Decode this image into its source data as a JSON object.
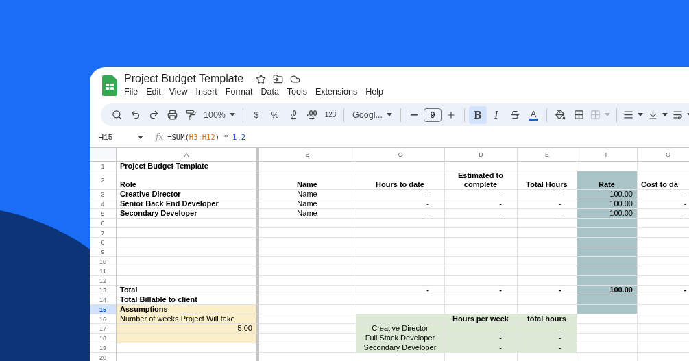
{
  "document": {
    "title": "Project Budget Template"
  },
  "menu": [
    {
      "label": "File"
    },
    {
      "label": "Edit"
    },
    {
      "label": "View"
    },
    {
      "label": "Insert"
    },
    {
      "label": "Format"
    },
    {
      "label": "Data"
    },
    {
      "label": "Tools"
    },
    {
      "label": "Extensions"
    },
    {
      "label": "Help"
    }
  ],
  "toolbar": {
    "zoom": "100%",
    "currency": "$",
    "percent": "%",
    "decrease_decimals": ".0",
    "increase_decimals": ".00",
    "number_format": "123",
    "font": "Googl...",
    "font_size": "9",
    "bold": {
      "label": "B",
      "selected": true
    },
    "italic": {
      "label": "I",
      "selected": false
    },
    "text_color": "A",
    "merge_disabled": true
  },
  "formula_bar": {
    "cell": "H15",
    "fx": "fx",
    "formula": [
      {
        "text": "=SUM(",
        "kind": "plain"
      },
      {
        "text": "H3:H12",
        "kind": "range"
      },
      {
        "text": ") * ",
        "kind": "plain"
      },
      {
        "text": "1.2",
        "kind": "number"
      }
    ]
  },
  "columns": [
    "A",
    "B",
    "C",
    "D",
    "E",
    "F",
    "G"
  ],
  "rows": [
    {
      "number": "1",
      "selected": false,
      "cells": [
        {
          "text": "Project Budget Template",
          "bold": true,
          "kind": "left"
        },
        {},
        {},
        {},
        {},
        {},
        {}
      ]
    },
    {
      "number": "2",
      "selected": false,
      "cells": [
        {
          "text": "Role",
          "bold": true,
          "kind": "left"
        },
        {
          "text": "Name",
          "bold": true,
          "kind": "center"
        },
        {
          "text": "Hours to date",
          "bold": true,
          "kind": "center"
        },
        {
          "text": "Estimated to complete",
          "bold": true,
          "kind": "center"
        },
        {
          "text": "Total Hours",
          "bold": true,
          "kind": "center"
        },
        {
          "text": "Rate",
          "bold": true,
          "kind": "center",
          "color": "#a9c3c7"
        },
        {
          "text": "Cost to da",
          "bold": true,
          "kind": "left"
        }
      ]
    },
    {
      "number": "3",
      "selected": false,
      "cells": [
        {
          "text": "Creative Director",
          "bold": true,
          "kind": "left"
        },
        {
          "text": "Name",
          "kind": "center"
        },
        {
          "text": "-",
          "kind": "dash"
        },
        {
          "text": "-",
          "kind": "dash"
        },
        {
          "text": "-",
          "kind": "dash"
        },
        {
          "text": "100.00",
          "kind": "right",
          "color": "#a9c3c7"
        },
        {
          "text": "-",
          "kind": "dash"
        }
      ]
    },
    {
      "number": "4",
      "selected": false,
      "cells": [
        {
          "text": "Senior Back End Developer",
          "bold": true,
          "kind": "left"
        },
        {
          "text": "Name",
          "kind": "center"
        },
        {
          "text": "-",
          "kind": "dash"
        },
        {
          "text": "-",
          "kind": "dash"
        },
        {
          "text": "-",
          "kind": "dash"
        },
        {
          "text": "100.00",
          "kind": "right",
          "color": "#a9c3c7"
        },
        {
          "text": "-",
          "kind": "dash"
        }
      ]
    },
    {
      "number": "5",
      "selected": false,
      "cells": [
        {
          "text": "Secondary Developer",
          "bold": true,
          "kind": "left"
        },
        {
          "text": "Name",
          "kind": "center"
        },
        {
          "text": "-",
          "kind": "dash"
        },
        {
          "text": "-",
          "kind": "dash"
        },
        {
          "text": "-",
          "kind": "dash"
        },
        {
          "text": "100.00",
          "kind": "right",
          "color": "#a9c3c7"
        },
        {
          "text": "-",
          "kind": "dash"
        }
      ]
    },
    {
      "number": "6",
      "selected": false,
      "cells": [
        {},
        {},
        {},
        {},
        {},
        {
          "color": "#a9c3c7"
        },
        {}
      ]
    },
    {
      "number": "7",
      "selected": false,
      "cells": [
        {},
        {},
        {},
        {},
        {},
        {
          "color": "#a9c3c7"
        },
        {}
      ]
    },
    {
      "number": "8",
      "selected": false,
      "cells": [
        {},
        {},
        {},
        {},
        {},
        {
          "color": "#a9c3c7"
        },
        {}
      ]
    },
    {
      "number": "9",
      "selected": false,
      "cells": [
        {},
        {},
        {},
        {},
        {},
        {
          "color": "#a9c3c7"
        },
        {}
      ]
    },
    {
      "number": "10",
      "selected": false,
      "cells": [
        {},
        {},
        {},
        {},
        {},
        {
          "color": "#a9c3c7"
        },
        {}
      ]
    },
    {
      "number": "11",
      "selected": false,
      "cells": [
        {},
        {},
        {},
        {},
        {},
        {
          "color": "#a9c3c7"
        },
        {}
      ]
    },
    {
      "number": "12",
      "selected": false,
      "cells": [
        {},
        {},
        {},
        {},
        {},
        {
          "color": "#a9c3c7"
        },
        {}
      ]
    },
    {
      "number": "13",
      "selected": false,
      "cells": [
        {
          "text": "Total",
          "bold": true,
          "kind": "left"
        },
        {},
        {
          "text": "-",
          "bold": true,
          "kind": "dash"
        },
        {
          "text": "-",
          "bold": true,
          "kind": "dash"
        },
        {
          "text": "-",
          "bold": true,
          "kind": "dash"
        },
        {
          "text": "100.00",
          "bold": true,
          "kind": "right",
          "color": "#a9c3c7"
        },
        {
          "text": "-",
          "bold": true,
          "kind": "dash"
        }
      ]
    },
    {
      "number": "14",
      "selected": false,
      "cells": [
        {
          "text": "Total Billable to client",
          "bold": true,
          "kind": "left"
        },
        {},
        {},
        {},
        {},
        {
          "color": "#a9c3c7"
        },
        {}
      ]
    },
    {
      "number": "15",
      "selected": true,
      "cells": [
        {
          "text": "Assumptions",
          "bold": true,
          "kind": "left",
          "color": "#fbefc9"
        },
        {},
        {},
        {},
        {},
        {
          "color": "#a9c3c7"
        },
        {}
      ]
    },
    {
      "number": "16",
      "selected": false,
      "cells": [
        {
          "text": "Number of weeks Project Will take",
          "kind": "left",
          "color": "#fbefc9"
        },
        {},
        {
          "color": "#dce9d5"
        },
        {
          "text": "Hours per week",
          "bold": true,
          "kind": "center",
          "color": "#dce9d5"
        },
        {
          "text": "total hours",
          "bold": true,
          "kind": "center",
          "color": "#dce9d5"
        },
        {},
        {}
      ]
    },
    {
      "number": "17",
      "selected": false,
      "cells": [
        {
          "text": "5.00",
          "kind": "right",
          "color": "#fbefc9"
        },
        {},
        {
          "text": "Creative Director",
          "kind": "center",
          "color": "#dce9d5"
        },
        {
          "text": "-",
          "kind": "dash",
          "color": "#dce9d5"
        },
        {
          "text": "-",
          "kind": "dash",
          "color": "#dce9d5"
        },
        {},
        {}
      ]
    },
    {
      "number": "18",
      "selected": false,
      "cells": [
        {
          "color": "#fbefc9"
        },
        {},
        {
          "text": "Full Stack Developer",
          "kind": "center",
          "color": "#dce9d5"
        },
        {
          "text": "-",
          "kind": "dash",
          "color": "#dce9d5"
        },
        {
          "text": "-",
          "kind": "dash",
          "color": "#dce9d5"
        },
        {},
        {}
      ]
    },
    {
      "number": "19",
      "selected": false,
      "cells": [
        {},
        {},
        {
          "text": "Secondary Developer",
          "kind": "center",
          "color": "#dce9d5"
        },
        {
          "text": "-",
          "kind": "dash",
          "color": "#dce9d5"
        },
        {
          "text": "-",
          "kind": "dash",
          "color": "#dce9d5"
        },
        {},
        {}
      ]
    },
    {
      "number": "20",
      "selected": false,
      "cells": [
        {},
        {},
        {},
        {},
        {},
        {},
        {}
      ]
    }
  ]
}
